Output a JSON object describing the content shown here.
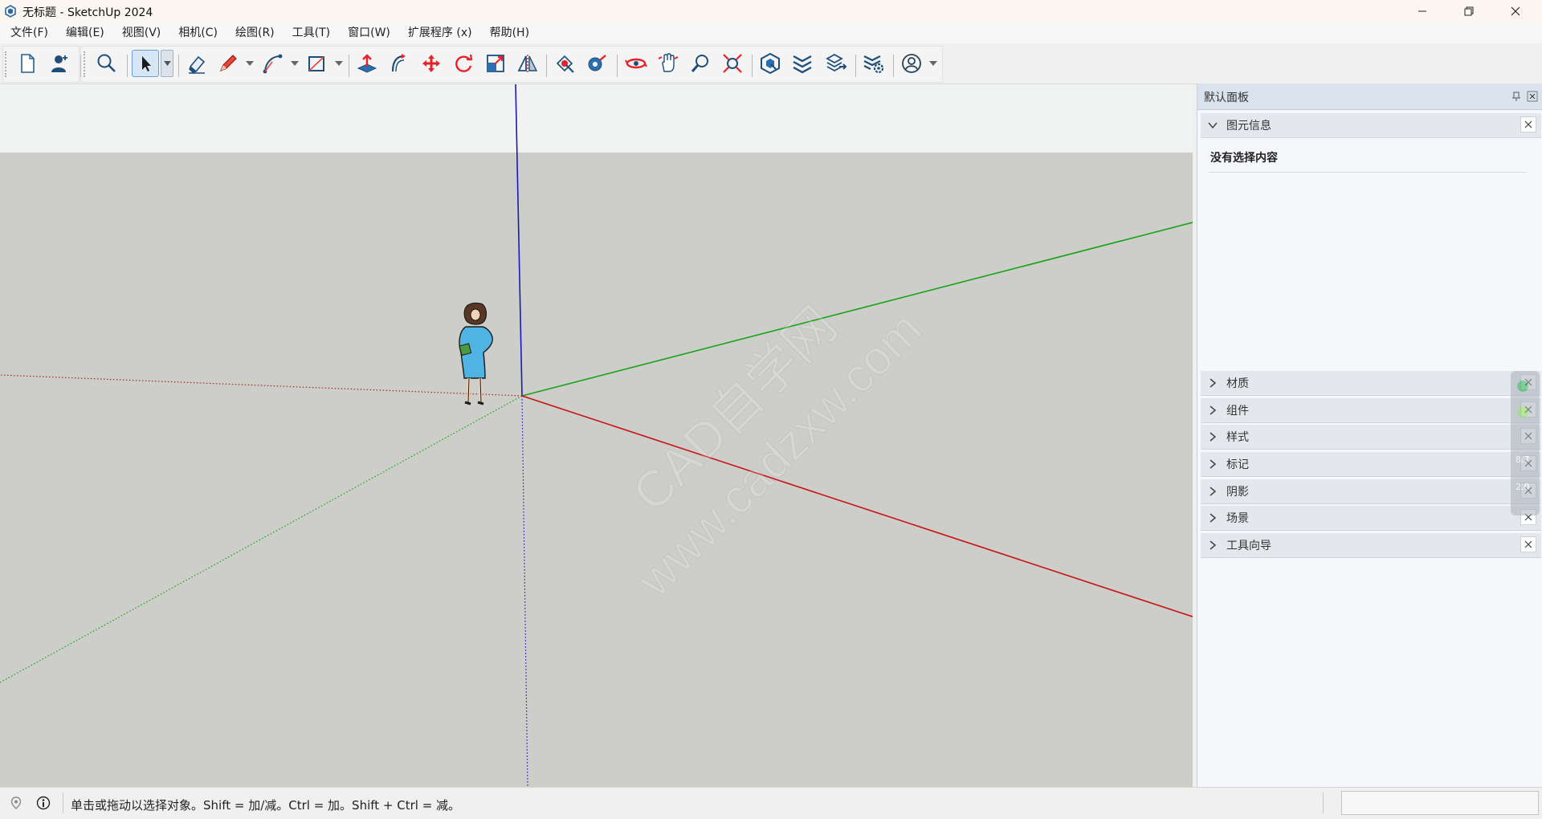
{
  "window": {
    "title": "无标题 - SketchUp 2024"
  },
  "menu": {
    "items": [
      "文件(F)",
      "编辑(E)",
      "视图(V)",
      "相机(C)",
      "绘图(R)",
      "工具(T)",
      "窗口(W)",
      "扩展程序 (x)",
      "帮助(H)"
    ]
  },
  "toolbar": {
    "tools": [
      {
        "name": "new-file-icon"
      },
      {
        "name": "add-user-icon"
      },
      {
        "name": "search-icon"
      },
      {
        "name": "select-arrow-icon"
      },
      {
        "name": "eraser-icon"
      },
      {
        "name": "pencil-line-icon"
      },
      {
        "name": "arc-icon"
      },
      {
        "name": "rectangle-icon"
      },
      {
        "name": "push-pull-icon"
      },
      {
        "name": "offset-icon"
      },
      {
        "name": "move-icon"
      },
      {
        "name": "rotate-icon"
      },
      {
        "name": "scale-icon"
      },
      {
        "name": "flip-icon"
      },
      {
        "name": "paint-bucket-icon"
      },
      {
        "name": "tape-measure-icon"
      },
      {
        "name": "orbit-icon"
      },
      {
        "name": "pan-icon"
      },
      {
        "name": "zoom-icon"
      },
      {
        "name": "zoom-extents-icon"
      },
      {
        "name": "warehouse-icon"
      },
      {
        "name": "extension-warehouse-icon"
      },
      {
        "name": "layout-send-icon"
      },
      {
        "name": "extension-manager-icon"
      },
      {
        "name": "account-icon"
      }
    ]
  },
  "tray": {
    "title": "默认面板",
    "entity_info": {
      "label": "图元信息",
      "status": "没有选择内容"
    },
    "panels": [
      {
        "label": "材质"
      },
      {
        "label": "组件"
      },
      {
        "label": "样式"
      },
      {
        "label": "标记"
      },
      {
        "label": "阴影"
      },
      {
        "label": "场景"
      },
      {
        "label": "工具向导"
      }
    ],
    "side_widget_values": [
      "8.7",
      "2.0"
    ]
  },
  "status": {
    "hint": "单击或拖动以选择对象。Shift = 加/减。Ctrl = 加。Shift + Ctrl = 减。"
  },
  "watermark": "CAD自学网 www.cadzxw.com",
  "colors": {
    "sky": "#f1f3f3",
    "ground": "#cdcdc9",
    "axis_red": "#c81414",
    "axis_green": "#17a317",
    "axis_blue": "#1a1ab8",
    "tray_header": "#d9e3ee",
    "active_tool": "#d6e6f5"
  }
}
